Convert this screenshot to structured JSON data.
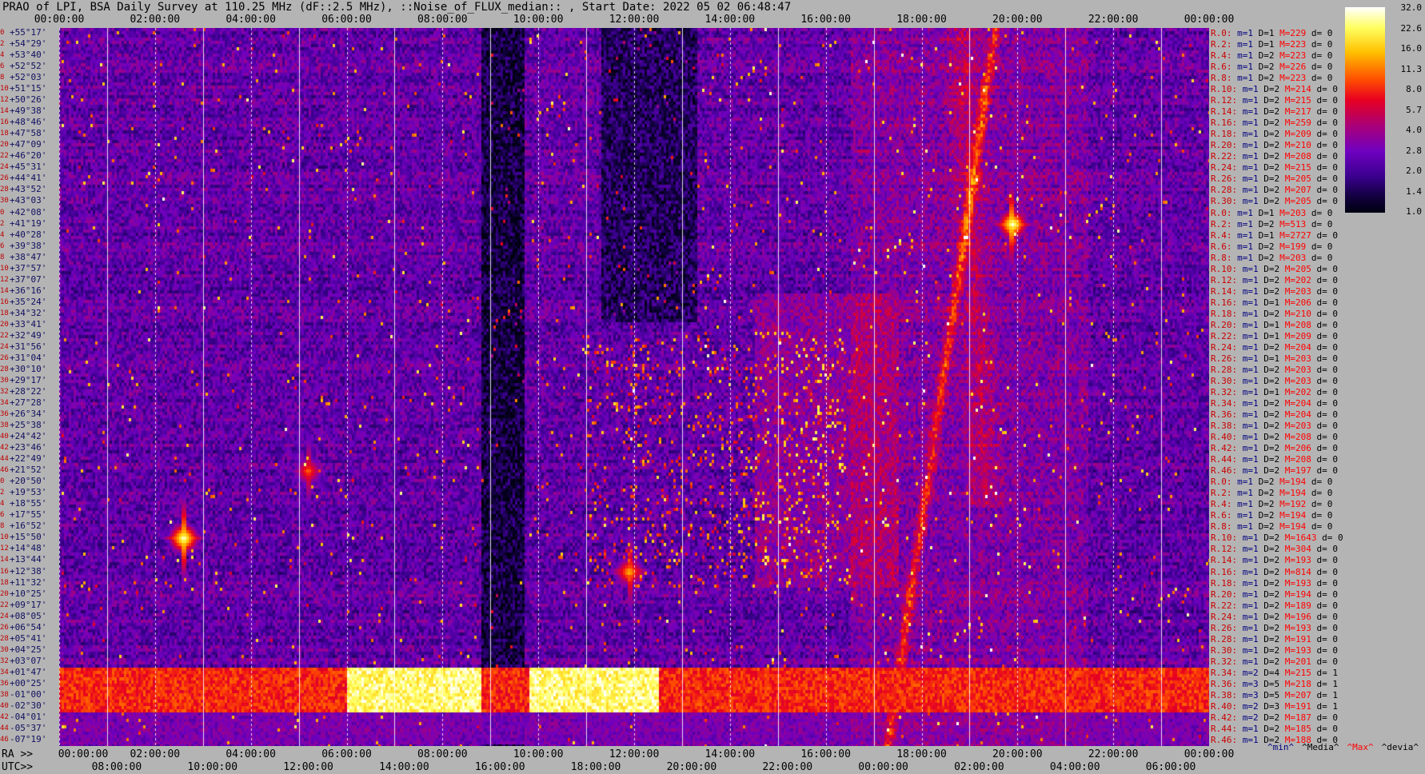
{
  "title": "PRAO of LPI, BSA Daily Survey at 110.25 MHz (dF::2.5 MHz), ::Noise_of_FLUX_median:: , Start Date: 2022 05 02 06:48:47",
  "ra_prefix": "RA >>",
  "utc_prefix": "UTC>>",
  "chart_data": {
    "type": "heatmap",
    "title": "PRAO of LPI, BSA Daily Survey at 110.25 MHz (dF::2.5 MHz), ::Noise_of_FLUX_median:: , Start Date: 2022 05 02 06:48:47",
    "xlabel_top": "",
    "top_ticks": [
      "00:00:00",
      "02:00:00",
      "04:00:00",
      "06:00:00",
      "08:00:00",
      "10:00:00",
      "12:00:00",
      "14:00:00",
      "16:00:00",
      "18:00:00",
      "20:00:00",
      "22:00:00",
      "00:00:00"
    ],
    "ra_ticks": [
      "00:00:00",
      "02:00:00",
      "04:00:00",
      "06:00:00",
      "08:00:00",
      "10:00:00",
      "12:00:00",
      "14:00:00",
      "16:00:00",
      "18:00:00",
      "20:00:00",
      "22:00:00",
      "00:00:00"
    ],
    "utc_ticks": [
      "08:00:00",
      "10:00:00",
      "12:00:00",
      "14:00:00",
      "16:00:00",
      "18:00:00",
      "20:00:00",
      "22:00:00",
      "00:00:00",
      "02:00:00",
      "04:00:00",
      "06:00:00"
    ],
    "declinations": [
      "+55°17'",
      "+54°29'",
      "+53°40'",
      "+52°52'",
      "+52°03'",
      "+51°15'",
      "+50°26'",
      "+49°38'",
      "+48°46'",
      "+47°58'",
      "+47°09'",
      "+46°20'",
      "+45°31'",
      "+44°41'",
      "+43°52'",
      "+43°03'",
      "+42°08'",
      "+41°19'",
      "+40°28'",
      "+39°38'",
      "+38°47'",
      "+37°57'",
      "+37°07'",
      "+36°16'",
      "+35°24'",
      "+34°32'",
      "+33°41'",
      "+32°49'",
      "+31°56'",
      "+31°04'",
      "+30°10'",
      "+29°17'",
      "+28°22'",
      "+27°28'",
      "+26°34'",
      "+25°38'",
      "+24°42'",
      "+23°46'",
      "+22°49'",
      "+21°52'",
      "+20°50'",
      "+19°53'",
      "+18°55'",
      "+17°55'",
      "+16°52'",
      "+15°50'",
      "+14°48'",
      "+13°44'",
      "+12°38'",
      "+11°32'",
      "+10°25'",
      "+09°17'",
      "+08°05'",
      "+06°54'",
      "+05°41'",
      "+04°25'",
      "+03°07'",
      "+01°47'",
      "+00°25'",
      "-01°00'",
      "-02°30'",
      "-04°01'",
      "-05°37'",
      "-07°19'"
    ],
    "row_indices": [
      "0",
      "2",
      "4",
      "6",
      "8",
      "10",
      "12",
      "14",
      "16",
      "18",
      "20",
      "22",
      "24",
      "26",
      "28",
      "30",
      "0",
      "2",
      "4",
      "6",
      "8",
      "10",
      "12",
      "14",
      "16",
      "18",
      "20",
      "22",
      "24",
      "26",
      "28",
      "30",
      "32",
      "34",
      "36",
      "38",
      "40",
      "42",
      "44",
      "46",
      "0",
      "2",
      "4",
      "6",
      "8",
      "10",
      "12",
      "14",
      "16",
      "18",
      "20",
      "22",
      "24",
      "26",
      "28",
      "30",
      "32",
      "34",
      "36",
      "38",
      "40",
      "42",
      "44",
      "46"
    ],
    "colorbar_ticks": [
      "32.0",
      "22.6",
      "16.0",
      "11.3",
      "8.0",
      "5.7",
      "4.0",
      "2.8",
      "2.0",
      "1.4",
      "1.0"
    ],
    "colorbar_range": [
      1.0,
      32.0
    ],
    "colorscale": "log",
    "bright_sources": [
      {
        "ra_h": 2.6,
        "dec_index": 45,
        "strength": 32
      },
      {
        "ra_h": 19.9,
        "dec_index": 17,
        "strength": 32
      },
      {
        "ra_h": 11.9,
        "dec_index": 48,
        "strength": 16
      },
      {
        "ra_h": 5.2,
        "dec_index": 39,
        "strength": 11
      }
    ],
    "band_dec_range": [
      "+01°47'",
      "-02°30'"
    ],
    "rows": [
      {
        "label": "R.0:",
        "m": "m=1",
        "D": "D=1",
        "M": "M=229",
        "d": "d= 0"
      },
      {
        "label": "R.2:",
        "m": "m=1",
        "D": "D=1",
        "M": "M=223",
        "d": "d= 0"
      },
      {
        "label": "R.4:",
        "m": "m=1",
        "D": "D=2",
        "M": "M=223",
        "d": "d= 0"
      },
      {
        "label": "R.6:",
        "m": "m=1",
        "D": "D=2",
        "M": "M=226",
        "d": "d= 0"
      },
      {
        "label": "R.8:",
        "m": "m=1",
        "D": "D=2",
        "M": "M=223",
        "d": "d= 0"
      },
      {
        "label": "R.10:",
        "m": "m=1",
        "D": "D=2",
        "M": "M=214",
        "d": "d= 0"
      },
      {
        "label": "R.12:",
        "m": "m=1",
        "D": "D=2",
        "M": "M=215",
        "d": "d= 0"
      },
      {
        "label": "R.14:",
        "m": "m=1",
        "D": "D=2",
        "M": "M=217",
        "d": "d= 0"
      },
      {
        "label": "R.16:",
        "m": "m=1",
        "D": "D=2",
        "M": "M=259",
        "d": "d= 0"
      },
      {
        "label": "R.18:",
        "m": "m=1",
        "D": "D=2",
        "M": "M=209",
        "d": "d= 0"
      },
      {
        "label": "R.20:",
        "m": "m=1",
        "D": "D=2",
        "M": "M=210",
        "d": "d= 0"
      },
      {
        "label": "R.22:",
        "m": "m=1",
        "D": "D=2",
        "M": "M=208",
        "d": "d= 0"
      },
      {
        "label": "R.24:",
        "m": "m=1",
        "D": "D=2",
        "M": "M=215",
        "d": "d= 0"
      },
      {
        "label": "R.26:",
        "m": "m=1",
        "D": "D=2",
        "M": "M=205",
        "d": "d= 0"
      },
      {
        "label": "R.28:",
        "m": "m=1",
        "D": "D=2",
        "M": "M=207",
        "d": "d= 0"
      },
      {
        "label": "R.30:",
        "m": "m=1",
        "D": "D=2",
        "M": "M=205",
        "d": "d= 0"
      },
      {
        "label": "R.0:",
        "m": "m=1",
        "D": "D=1",
        "M": "M=203",
        "d": "d= 0"
      },
      {
        "label": "R.2:",
        "m": "m=1",
        "D": "D=2",
        "M": "M=513",
        "d": "d= 0"
      },
      {
        "label": "R.4:",
        "m": "m=1",
        "D": "D=1",
        "M": "M=2727",
        "d": "d= 0"
      },
      {
        "label": "R.6:",
        "m": "m=1",
        "D": "D=2",
        "M": "M=199",
        "d": "d= 0"
      },
      {
        "label": "R.8:",
        "m": "m=1",
        "D": "D=2",
        "M": "M=203",
        "d": "d= 0"
      },
      {
        "label": "R.10:",
        "m": "m=1",
        "D": "D=2",
        "M": "M=205",
        "d": "d= 0"
      },
      {
        "label": "R.12:",
        "m": "m=1",
        "D": "D=2",
        "M": "M=202",
        "d": "d= 0"
      },
      {
        "label": "R.14:",
        "m": "m=1",
        "D": "D=2",
        "M": "M=203",
        "d": "d= 0"
      },
      {
        "label": "R.16:",
        "m": "m=1",
        "D": "D=1",
        "M": "M=206",
        "d": "d= 0"
      },
      {
        "label": "R.18:",
        "m": "m=1",
        "D": "D=2",
        "M": "M=210",
        "d": "d= 0"
      },
      {
        "label": "R.20:",
        "m": "m=1",
        "D": "D=1",
        "M": "M=208",
        "d": "d= 0"
      },
      {
        "label": "R.22:",
        "m": "m=1",
        "D": "D=1",
        "M": "M=209",
        "d": "d= 0"
      },
      {
        "label": "R.24:",
        "m": "m=1",
        "D": "D=2",
        "M": "M=204",
        "d": "d= 0"
      },
      {
        "label": "R.26:",
        "m": "m=1",
        "D": "D=1",
        "M": "M=203",
        "d": "d= 0"
      },
      {
        "label": "R.28:",
        "m": "m=1",
        "D": "D=2",
        "M": "M=203",
        "d": "d= 0"
      },
      {
        "label": "R.30:",
        "m": "m=1",
        "D": "D=2",
        "M": "M=203",
        "d": "d= 0"
      },
      {
        "label": "R.32:",
        "m": "m=1",
        "D": "D=1",
        "M": "M=202",
        "d": "d= 0"
      },
      {
        "label": "R.34:",
        "m": "m=1",
        "D": "D=2",
        "M": "M=204",
        "d": "d= 0"
      },
      {
        "label": "R.36:",
        "m": "m=1",
        "D": "D=2",
        "M": "M=204",
        "d": "d= 0"
      },
      {
        "label": "R.38:",
        "m": "m=1",
        "D": "D=2",
        "M": "M=203",
        "d": "d= 0"
      },
      {
        "label": "R.40:",
        "m": "m=1",
        "D": "D=2",
        "M": "M=208",
        "d": "d= 0"
      },
      {
        "label": "R.42:",
        "m": "m=1",
        "D": "D=2",
        "M": "M=206",
        "d": "d= 0"
      },
      {
        "label": "R.44:",
        "m": "m=1",
        "D": "D=2",
        "M": "M=208",
        "d": "d= 0"
      },
      {
        "label": "R.46:",
        "m": "m=1",
        "D": "D=2",
        "M": "M=197",
        "d": "d= 0"
      },
      {
        "label": "R.0:",
        "m": "m=1",
        "D": "D=2",
        "M": "M=194",
        "d": "d= 0"
      },
      {
        "label": "R.2:",
        "m": "m=1",
        "D": "D=2",
        "M": "M=194",
        "d": "d= 0"
      },
      {
        "label": "R.4:",
        "m": "m=1",
        "D": "D=2",
        "M": "M=192",
        "d": "d= 0"
      },
      {
        "label": "R.6:",
        "m": "m=1",
        "D": "D=2",
        "M": "M=194",
        "d": "d= 0"
      },
      {
        "label": "R.8:",
        "m": "m=1",
        "D": "D=2",
        "M": "M=194",
        "d": "d= 0"
      },
      {
        "label": "R.10:",
        "m": "m=1",
        "D": "D=2",
        "M": "M=1643",
        "d": "d= 0"
      },
      {
        "label": "R.12:",
        "m": "m=1",
        "D": "D=2",
        "M": "M=304",
        "d": "d= 0"
      },
      {
        "label": "R.14:",
        "m": "m=1",
        "D": "D=2",
        "M": "M=193",
        "d": "d= 0"
      },
      {
        "label": "R.16:",
        "m": "m=1",
        "D": "D=2",
        "M": "M=814",
        "d": "d= 0"
      },
      {
        "label": "R.18:",
        "m": "m=1",
        "D": "D=2",
        "M": "M=193",
        "d": "d= 0"
      },
      {
        "label": "R.20:",
        "m": "m=1",
        "D": "D=2",
        "M": "M=194",
        "d": "d= 0"
      },
      {
        "label": "R.22:",
        "m": "m=1",
        "D": "D=2",
        "M": "M=189",
        "d": "d= 0"
      },
      {
        "label": "R.24:",
        "m": "m=1",
        "D": "D=2",
        "M": "M=196",
        "d": "d= 0"
      },
      {
        "label": "R.26:",
        "m": "m=1",
        "D": "D=2",
        "M": "M=193",
        "d": "d= 0"
      },
      {
        "label": "R.28:",
        "m": "m=1",
        "D": "D=2",
        "M": "M=191",
        "d": "d= 0"
      },
      {
        "label": "R.30:",
        "m": "m=1",
        "D": "D=2",
        "M": "M=193",
        "d": "d= 0"
      },
      {
        "label": "R.32:",
        "m": "m=1",
        "D": "D=2",
        "M": "M=201",
        "d": "d= 0"
      },
      {
        "label": "R.34:",
        "m": "m=2",
        "D": "D=4",
        "M": "M=215",
        "d": "d= 1"
      },
      {
        "label": "R.36:",
        "m": "m=3",
        "D": "D=5",
        "M": "M=218",
        "d": "d= 1"
      },
      {
        "label": "R.38:",
        "m": "m=3",
        "D": "D=5",
        "M": "M=207",
        "d": "d= 1"
      },
      {
        "label": "R.40:",
        "m": "m=2",
        "D": "D=3",
        "M": "M=191",
        "d": "d= 1"
      },
      {
        "label": "R.42:",
        "m": "m=2",
        "D": "D=2",
        "M": "M=187",
        "d": "d= 0"
      },
      {
        "label": "R.44:",
        "m": "m=1",
        "D": "D=2",
        "M": "M=185",
        "d": "d= 0"
      },
      {
        "label": "R.46:",
        "m": "m=1",
        "D": "D=2",
        "M": "M=188",
        "d": "d= 0"
      }
    ]
  },
  "legend": {
    "min": "^min^",
    "media": "^Media^",
    "max": "^Max^",
    "devia": "^devia^",
    "colors": {
      "min": "#000080",
      "media": "#000000",
      "max": "#ff0000",
      "devia": "#000000"
    }
  }
}
